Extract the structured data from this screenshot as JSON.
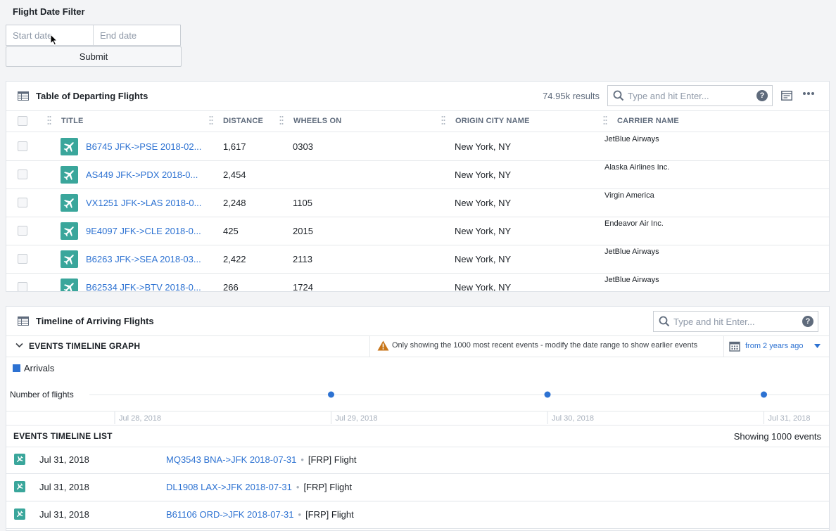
{
  "filter": {
    "title": "Flight Date Filter",
    "start_placeholder": "Start date",
    "end_placeholder": "End date",
    "submit_label": "Submit"
  },
  "departing": {
    "title": "Table of Departing Flights",
    "results": "74.95k results",
    "search_placeholder": "Type and hit Enter...",
    "help": "?",
    "columns": [
      "TITLE",
      "DISTANCE",
      "WHEELS ON",
      "ORIGIN CITY NAME",
      "CARRIER NAME"
    ],
    "rows": [
      {
        "title": "B6745 JFK->PSE 2018-02...",
        "distance": "1,617",
        "wheels_on": "0303",
        "origin": "New York, NY",
        "carrier": "JetBlue Airways"
      },
      {
        "title": "AS449 JFK->PDX 2018-0...",
        "distance": "2,454",
        "wheels_on": "",
        "origin": "New York, NY",
        "carrier": "Alaska Airlines Inc."
      },
      {
        "title": "VX1251 JFK->LAS 2018-0...",
        "distance": "2,248",
        "wheels_on": "1105",
        "origin": "New York, NY",
        "carrier": "Virgin America"
      },
      {
        "title": "9E4097 JFK->CLE 2018-0...",
        "distance": "425",
        "wheels_on": "2015",
        "origin": "New York, NY",
        "carrier": "Endeavor Air Inc."
      },
      {
        "title": "B6263 JFK->SEA 2018-03...",
        "distance": "2,422",
        "wheels_on": "2113",
        "origin": "New York, NY",
        "carrier": "JetBlue Airways"
      },
      {
        "title": "B62534 JFK->BTV 2018-0...",
        "distance": "266",
        "wheels_on": "1724",
        "origin": "New York, NY",
        "carrier": "JetBlue Airways"
      }
    ]
  },
  "arriving": {
    "title": "Timeline of Arriving Flights",
    "search_placeholder": "Type and hit Enter...",
    "help": "?",
    "graph_title": "EVENTS TIMELINE GRAPH",
    "warning": "Only showing the 1000 most recent events - modify the date range to show earlier events",
    "range": "from 2 years ago",
    "legend": "Arrivals",
    "row_label": "Number of flights",
    "ticks": [
      "Jul 28, 2018",
      "Jul 29, 2018",
      "Jul 30, 2018",
      "Jul 31, 2018"
    ],
    "points": [
      "Jul 29, 2018",
      "Jul 30, 2018",
      "Jul 31, 2018"
    ],
    "list_title": "EVENTS TIMELINE LIST",
    "events_count": "Showing 1000 events",
    "events": [
      {
        "date": "Jul 31, 2018",
        "title": "MQ3543 BNA->JFK 2018-07-31",
        "type": "[FRP] Flight"
      },
      {
        "date": "Jul 31, 2018",
        "title": "DL1908 LAX->JFK 2018-07-31",
        "type": "[FRP] Flight"
      },
      {
        "date": "Jul 31, 2018",
        "title": "B61106 ORD->JFK 2018-07-31",
        "type": "[FRP] Flight"
      }
    ]
  },
  "colors": {
    "accent": "#2d72d2",
    "badge": "#3aa69b",
    "warning": "#c87619"
  }
}
